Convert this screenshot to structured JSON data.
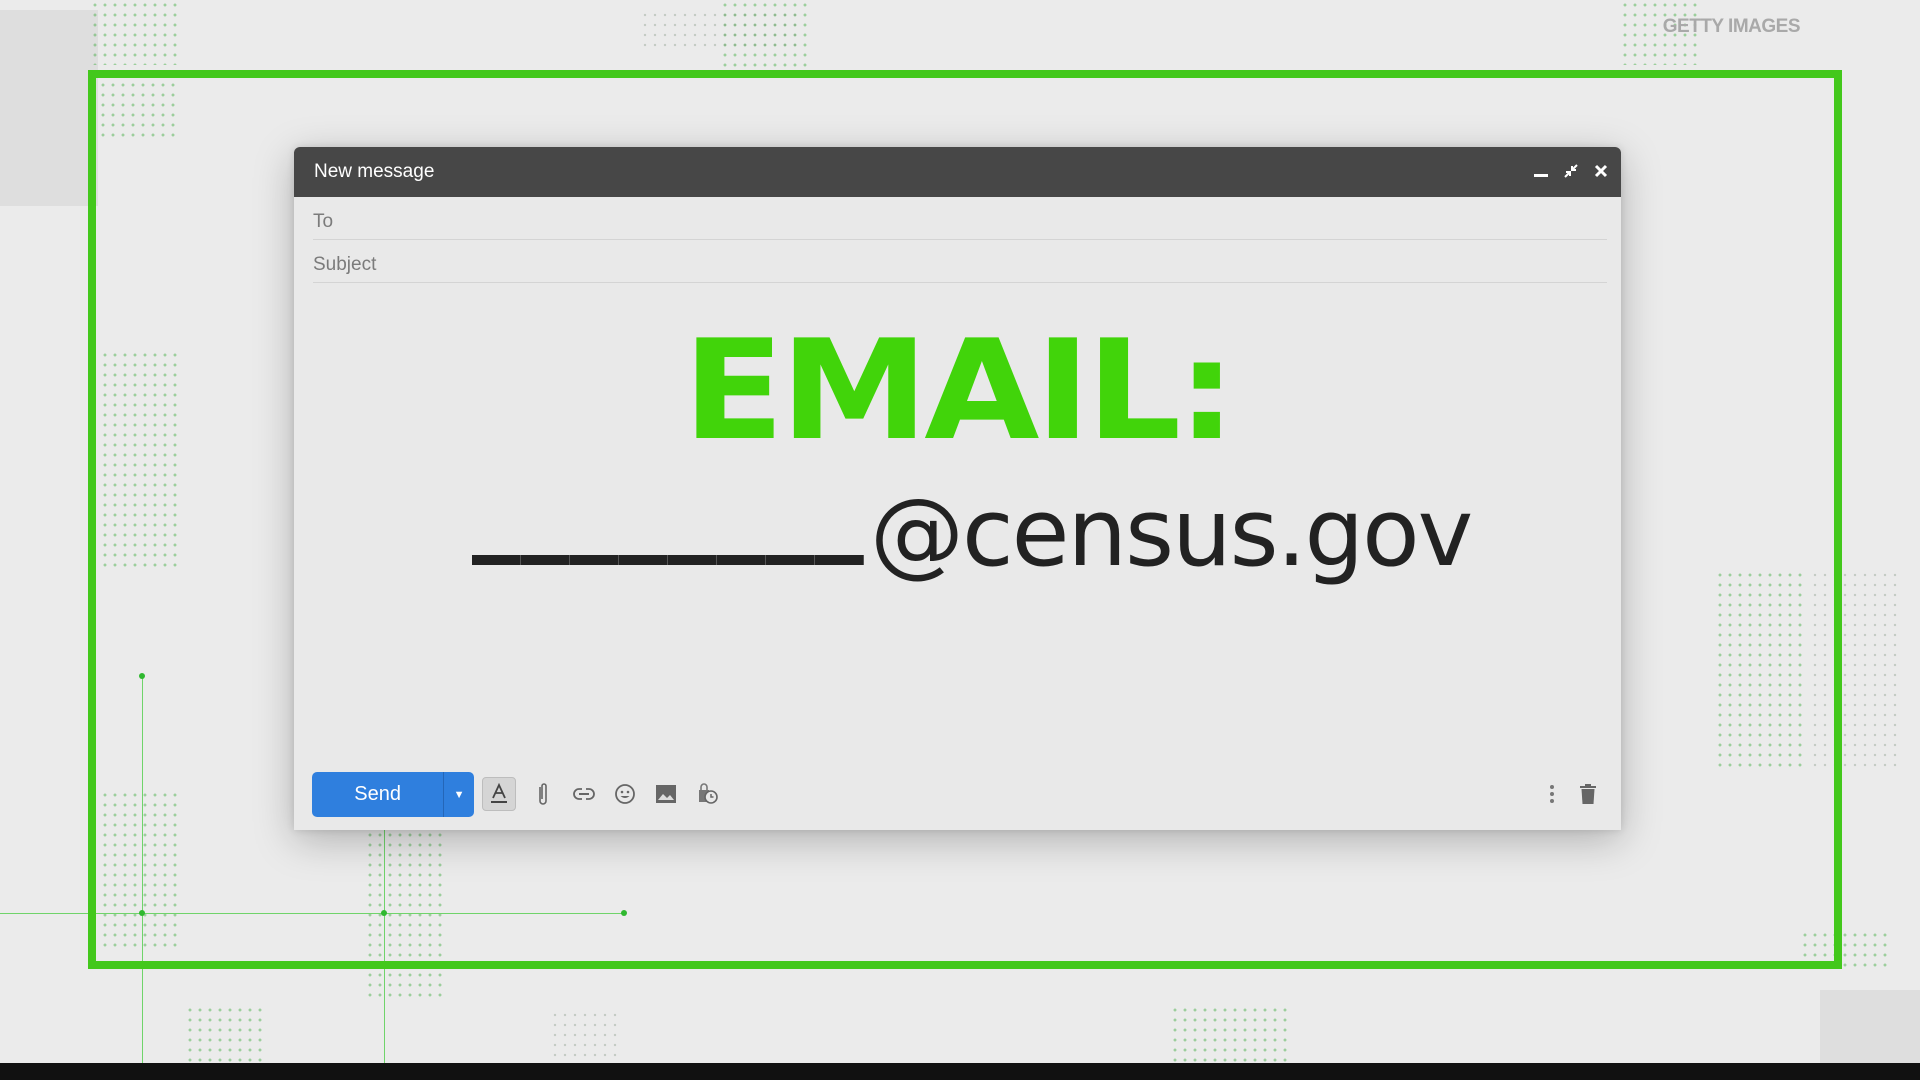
{
  "watermark": "GETTY IMAGES",
  "colors": {
    "accent_green": "#43c81c",
    "headline_green": "#41d40a",
    "send_blue": "#2f7fde",
    "header_gray": "#474747"
  },
  "compose": {
    "title": "New message",
    "controls": {
      "minimize": "minimize-icon",
      "fullscreen": "exit-fullscreen-icon",
      "close": "close-icon"
    },
    "to_label": "To",
    "to_value": "",
    "subject_label": "Subject",
    "subject_value": "",
    "body": {
      "headline": "EMAIL:",
      "blank_underscores": "________",
      "domain": "@census.gov"
    },
    "toolbar": {
      "send_label": "Send",
      "send_options_icon": "caret-down-icon",
      "icons": [
        "text-format-icon",
        "attach-icon",
        "link-icon",
        "emoji-icon",
        "image-icon",
        "schedule-icon"
      ],
      "more_icon": "more-vertical-icon",
      "discard_icon": "trash-icon"
    }
  }
}
